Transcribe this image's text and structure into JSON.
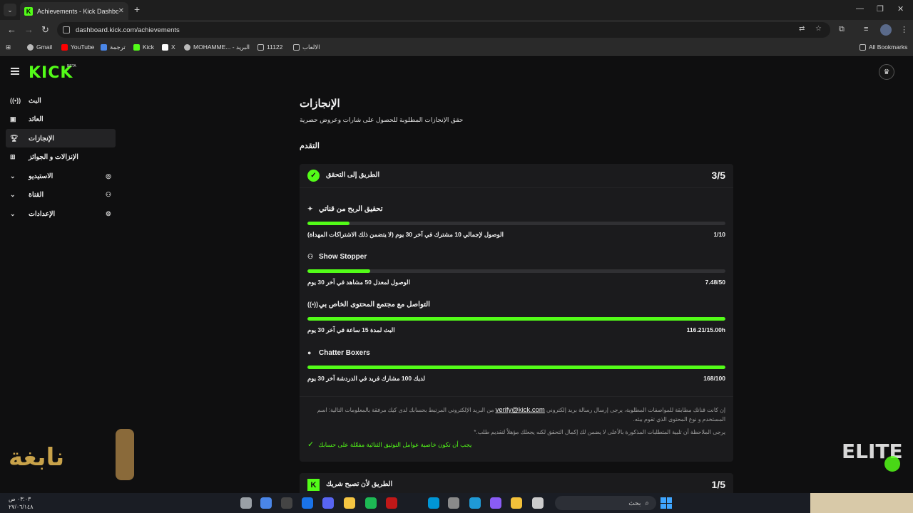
{
  "browser": {
    "tab_title": "Achievements - Kick Dashboard",
    "tab_favicon_letter": "K",
    "tab_close": "✕",
    "new_tab": "+",
    "url": "dashboard.kick.com/achievements",
    "bookmarks": [
      {
        "label": "Gmail",
        "color": "#bbbbbb"
      },
      {
        "label": "YouTube",
        "color": "#ff0000"
      },
      {
        "label": "ترجمة",
        "color": "#4a86e8"
      },
      {
        "label": "Kick",
        "color": "#53fc18"
      },
      {
        "label": "X",
        "color": "#ffffff"
      },
      {
        "label": "MOHAMME... - البريد",
        "color": "#bbbbbb"
      },
      {
        "label": "11122",
        "color": "#bbbbbb"
      },
      {
        "label": "الالعاب",
        "color": "#bbbbbb"
      }
    ],
    "all_bookmarks": "All Bookmarks"
  },
  "header": {
    "logo": "KICK",
    "beta": "BETA",
    "crown_icon": "♛"
  },
  "sidebar": {
    "items": [
      {
        "label": "البث",
        "icon": "((•))",
        "icon_name": "broadcast-icon",
        "active": false,
        "expandable": false
      },
      {
        "label": "العائد",
        "icon": "▣",
        "icon_name": "revenue-icon",
        "active": false,
        "expandable": false
      },
      {
        "label": "الإنجازات",
        "icon": "🏆︎",
        "icon_name": "trophy-icon",
        "active": true,
        "expandable": false
      },
      {
        "label": "الإنزالات و الجوائز",
        "icon": "⊞",
        "icon_name": "gift-icon",
        "active": false,
        "expandable": false
      },
      {
        "label": "الاستيديو",
        "icon": "⌄",
        "icon_name": "chevron-down-icon",
        "right_icon": "◎",
        "active": false,
        "expandable": true
      },
      {
        "label": "القناة",
        "icon": "⌄",
        "icon_name": "chevron-down-icon",
        "right_icon": "⚇",
        "active": false,
        "expandable": true
      },
      {
        "label": "الإعدادات",
        "icon": "⌄",
        "icon_name": "chevron-down-icon",
        "right_icon": "⚙",
        "active": false,
        "expandable": true
      }
    ]
  },
  "main": {
    "title": "الإنجازات",
    "subtitle": "حقق الإنجازات المطلوبة للحصول على شارات وعروض حصرية",
    "section": "التقدم",
    "card": {
      "title": "الطريق إلى التحقق",
      "count": "3/5",
      "achievements": [
        {
          "title": "تحقيق الربح من قناتي",
          "icon": "✦",
          "requirement": "الوصول لإجمالي 10 مشترك في آخر 30 يوم (لا يتضمن ذلك الاشتراكات المهداة)",
          "value": "1/10",
          "progress": 0.1
        },
        {
          "title": "Show Stopper",
          "icon": "⚇",
          "requirement": "الوصول لمعدل 50 مشاهد في آخر 30 يوم",
          "value": "7.48/50",
          "progress": 0.15
        },
        {
          "title": "التواصل مع مجتمع المحتوى الخاص بي",
          "icon": "((•))",
          "requirement": "البث لمدة 15 ساعة في آخر 30 يوم",
          "value": "116.21/15.00h",
          "progress": 1.0
        },
        {
          "title": "Chatter Boxers",
          "icon": "●",
          "requirement": "لديك 100 مشارك فريد في الدردشة آخر 30 يوم",
          "value": "168/100",
          "progress": 1.0
        }
      ],
      "note_pre": "إن كانت قناتك مطابقة للمواصفات المطلوبة، يرجى إرسال رسالة بريد إلكتروني",
      "note_email": "verify@kick.com",
      "note_post": "من البريد الإلكتروني المرتبط بحسابك لدى كيك مرفقة بالمعلومات التالية: اسم المستخدم و نوع المحتوى الذي تقوم ببثه.",
      "note_2": "يرجى الملاحظة أن تلبية المتطلبات المذكورة بالأعلى لا يضمن لك إكمال التحقق لكنه يجعلك مؤهلاً لتقديم طلب.*",
      "note_ok": "يجب أن تكون خاصية عوامل التوثيق الثنائية مفعّلة على حسابك"
    },
    "card2": {
      "title": "الطريق لأن تصبح شريك",
      "count": "1/5",
      "badge": "K"
    }
  },
  "overlays": {
    "left_logo": "نابغة",
    "right_logo": "ELITE"
  },
  "taskbar": {
    "time": "٠٣:٠٣ ص",
    "date": "٢٧/٠٦/١٤٨",
    "search": "بحث",
    "icons": [
      {
        "name": "settings-app-icon",
        "color": "#9aa0a6"
      },
      {
        "name": "chrome-app-icon",
        "color": "#4a86e8"
      },
      {
        "name": "obs-app-icon",
        "color": "#444444"
      },
      {
        "name": "chrome-profile-icon",
        "color": "#1a73e8"
      },
      {
        "name": "discord-app-icon",
        "color": "#5865f2"
      },
      {
        "name": "notes-app-icon",
        "color": "#f4c542"
      },
      {
        "name": "spotify-app-icon",
        "color": "#1db954"
      },
      {
        "name": "mcafee-app-icon",
        "color": "#c01818"
      },
      {
        "name": "hp-app-icon",
        "color": "#0096d6"
      },
      {
        "name": "store-app-icon",
        "color": "#8a8a8a"
      },
      {
        "name": "edge-app-icon",
        "color": "#1f9ad6"
      },
      {
        "name": "copilot-app-icon",
        "color": "#8a5cf6"
      },
      {
        "name": "files-app-icon",
        "color": "#f3c13a"
      },
      {
        "name": "app-window-icon",
        "color": "#cccccc"
      }
    ]
  }
}
